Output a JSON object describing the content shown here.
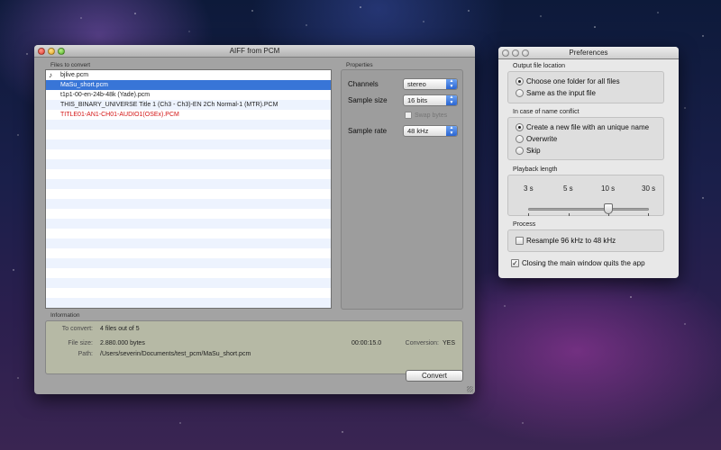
{
  "main_window": {
    "title": "AIFF from PCM",
    "files_label": "Files to convert",
    "files": [
      {
        "name": "bjlive.pcm",
        "icon": "music-note-icon",
        "selected": false,
        "error": false
      },
      {
        "name": "MaSu_short.pcm",
        "selected": true,
        "error": false
      },
      {
        "name": "t1p1-00-en-24b-48k (Yade).pcm",
        "selected": false,
        "error": false
      },
      {
        "name": "THIS_BINARY_UNIVERSE Title 1 (Ch3 - Ch3)-EN 2Ch Normal-1 (MTR).PCM",
        "selected": false,
        "error": false
      },
      {
        "name": "TITLE01-AN1-CH01-AUDIO1(OSEx).PCM",
        "selected": false,
        "error": true
      }
    ],
    "properties": {
      "label": "Properties",
      "channels_label": "Channels",
      "channels_value": "stereo",
      "sample_size_label": "Sample size",
      "sample_size_value": "16 bits",
      "swap_bytes_label": "Swap bytes",
      "sample_rate_label": "Sample rate",
      "sample_rate_value": "48 kHz"
    },
    "information": {
      "label": "Information",
      "to_convert_label": "To convert:",
      "to_convert_value": "4 files out of 5",
      "file_size_label": "File size:",
      "file_size_value": "2.880.000 bytes",
      "duration_value": "00:00:15.0",
      "conversion_label": "Conversion:",
      "conversion_value": "YES",
      "path_label": "Path:",
      "path_value": "/Users/severin/Documents/test_pcm/MaSu_short.pcm"
    },
    "convert_button": "Convert"
  },
  "preferences": {
    "title": "Preferences",
    "output_location": {
      "title": "Output file location",
      "options": [
        "Choose one folder for all files",
        "Same as the input file"
      ],
      "selected": 0
    },
    "name_conflict": {
      "title": "In case of name conflict",
      "options": [
        "Create a new file with an unique name",
        "Overwrite",
        "Skip"
      ],
      "selected": 0
    },
    "playback": {
      "title": "Playback length",
      "ticks": [
        "3 s",
        "5 s",
        "10 s",
        "30 s"
      ],
      "value": "10 s"
    },
    "process": {
      "title": "Process",
      "resample_label": "Resample 96 kHz to 48 kHz",
      "resample_checked": false
    },
    "quit_label": "Closing the main window quits the app",
    "quit_checked": true
  }
}
